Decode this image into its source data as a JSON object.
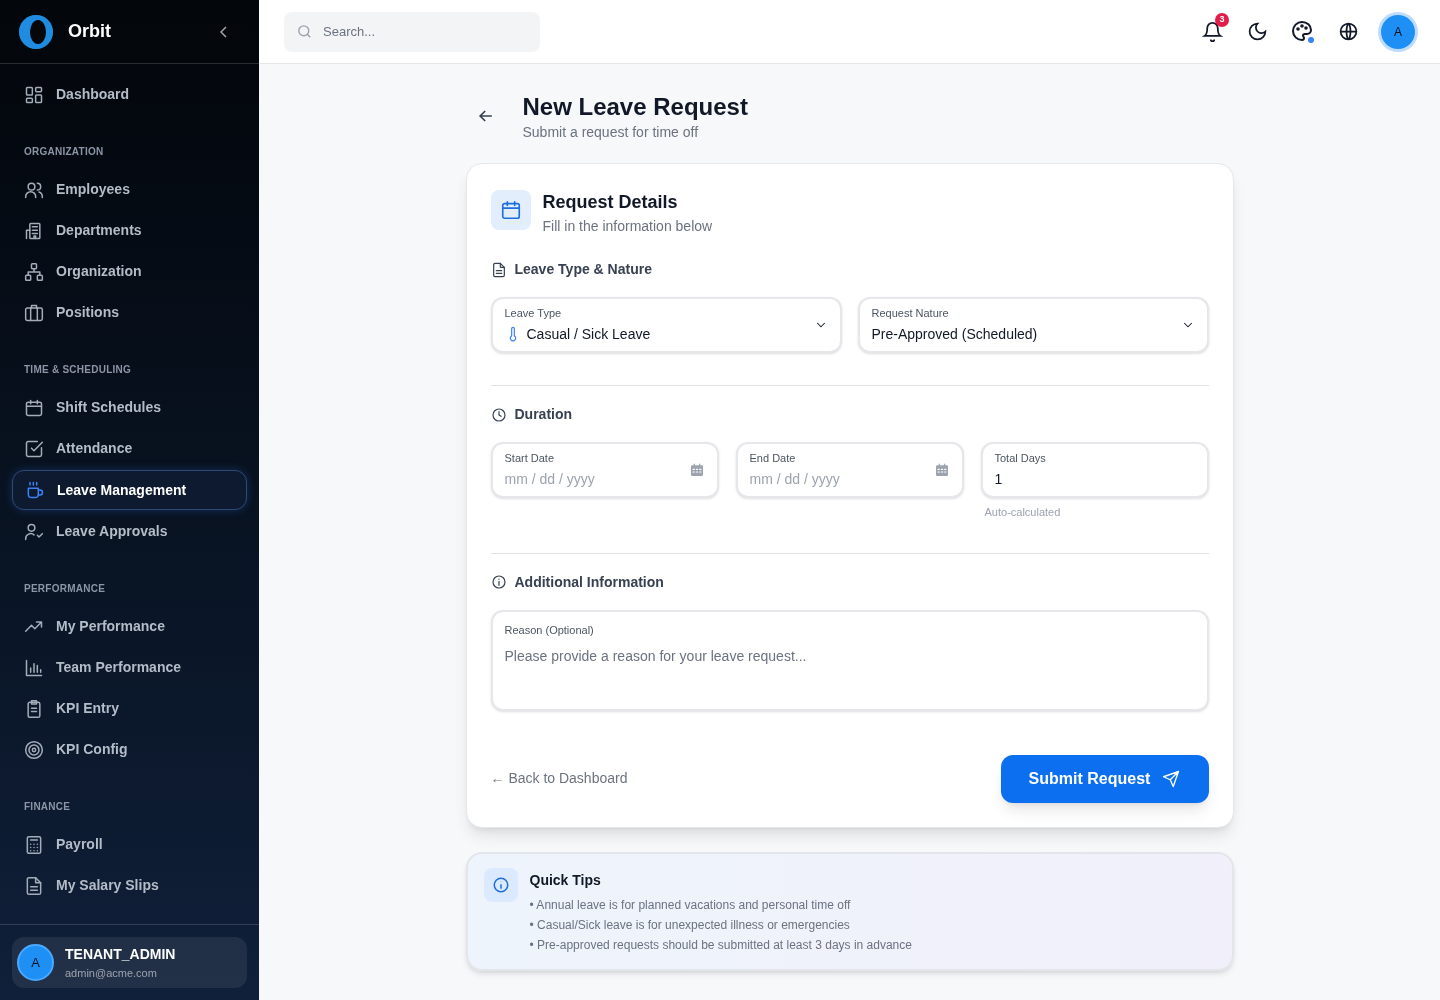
{
  "brand": {
    "name": "Orbit"
  },
  "sidebar": {
    "sections": [
      {
        "items": [
          {
            "label": "Dashboard",
            "selected": false
          }
        ]
      },
      {
        "heading": "ORGANIZATION",
        "items": [
          {
            "label": "Employees",
            "selected": false
          },
          {
            "label": "Departments",
            "selected": false
          },
          {
            "label": "Organization",
            "selected": false
          },
          {
            "label": "Positions",
            "selected": false
          }
        ]
      },
      {
        "heading": "TIME & SCHEDULING",
        "items": [
          {
            "label": "Shift Schedules",
            "selected": false
          },
          {
            "label": "Attendance",
            "selected": false
          },
          {
            "label": "Leave Management",
            "selected": true
          },
          {
            "label": "Leave Approvals",
            "selected": false
          }
        ]
      },
      {
        "heading": "PERFORMANCE",
        "items": [
          {
            "label": "My Performance",
            "selected": false
          },
          {
            "label": "Team Performance",
            "selected": false
          },
          {
            "label": "KPI Entry",
            "selected": false
          },
          {
            "label": "KPI Config",
            "selected": false
          }
        ]
      },
      {
        "heading": "FINANCE",
        "items": [
          {
            "label": "Payroll",
            "selected": false
          },
          {
            "label": "My Salary Slips",
            "selected": false
          }
        ]
      }
    ],
    "user": {
      "avatar": "A",
      "name": "TENANT_ADMIN",
      "email": "admin@acme.com"
    }
  },
  "topbar": {
    "search": {
      "placeholder": "Search..."
    },
    "notification_count": "3",
    "avatar": "A"
  },
  "page": {
    "title": "New Leave Request",
    "subtitle": "Submit a request for time off"
  },
  "form": {
    "title": "Request Details",
    "subtitle": "Fill in the information below",
    "sections": [
      {
        "kind": "selects",
        "title": "Leave Type & Nature",
        "fields": [
          {
            "label": "Leave Type",
            "value": "Casual / Sick Leave"
          },
          {
            "label": "Request Nature",
            "value": "Pre-Approved (Scheduled)"
          }
        ]
      },
      {
        "kind": "dates",
        "title": "Duration",
        "fields": [
          {
            "kind": "date",
            "label": "Start Date",
            "placeholder": "mm / dd / yyyy"
          },
          {
            "kind": "date",
            "label": "End Date",
            "placeholder": "mm / dd / yyyy"
          },
          {
            "kind": "number",
            "label": "Total Days",
            "value": "1",
            "hint": "Auto-calculated"
          }
        ]
      },
      {
        "kind": "textarea",
        "title": "Additional Information",
        "fields": [
          {
            "label": "Reason (Optional)",
            "placeholder": "Please provide a reason for your leave request..."
          }
        ]
      }
    ],
    "back_link": "← Back to Dashboard",
    "submit": "Submit Request"
  },
  "tips": {
    "title": "Quick Tips",
    "items": [
      "• Annual leave is for planned vacations and personal time off",
      "• Casual/Sick leave is for unexpected illness or emergencies",
      "• Pre-approved requests should be submitted at least 3 days in advance"
    ]
  }
}
